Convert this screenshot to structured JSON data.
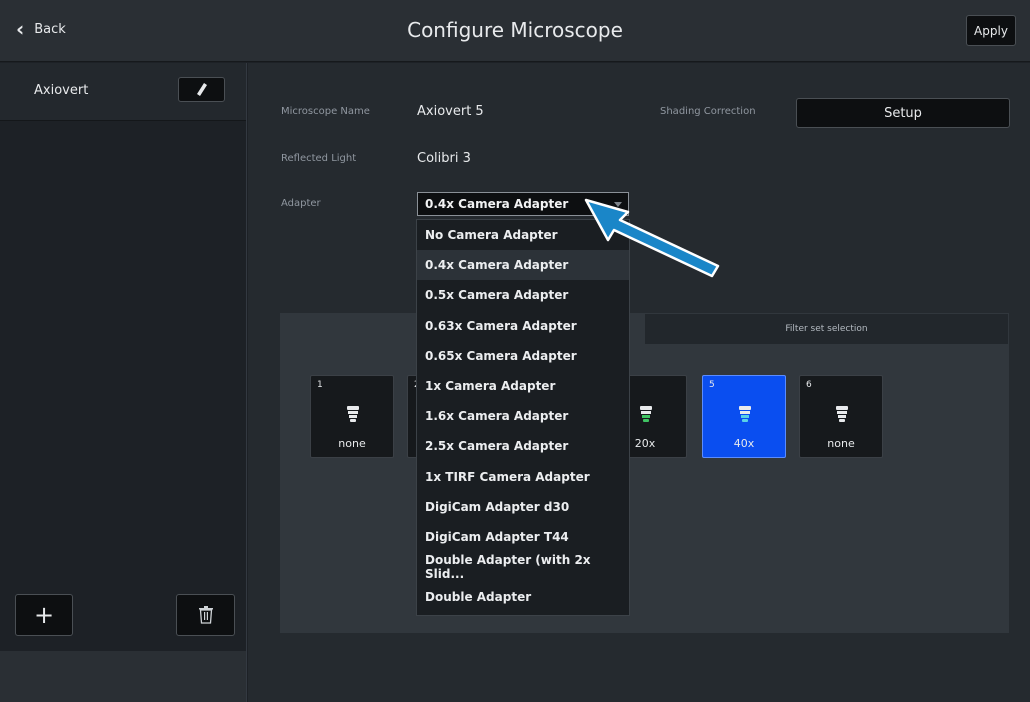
{
  "header": {
    "back_label": "Back",
    "title": "Configure Microscope",
    "apply_label": "Apply"
  },
  "sidebar": {
    "items": [
      {
        "label": "Axiovert"
      }
    ],
    "add_label": "+"
  },
  "form": {
    "microscope_name_label": "Microscope Name",
    "microscope_name_value": "Axiovert 5",
    "reflected_light_label": "Reflected Light",
    "reflected_light_value": "Colibri 3",
    "adapter_label": "Adapter",
    "adapter_value": "0.4x Camera Adapter",
    "shading_correction_label": "Shading Correction",
    "setup_label": "Setup"
  },
  "tabs": {
    "filter_set_selection": "Filter set selection"
  },
  "positions": [
    {
      "num": "1",
      "label": "none",
      "icon": "objective-white",
      "selected": false
    },
    {
      "num": "2",
      "label": "",
      "icon": "objective-white",
      "selected": false
    },
    {
      "num": "",
      "label": "20x",
      "icon": "objective-green",
      "selected": false
    },
    {
      "num": "5",
      "label": "40x",
      "icon": "objective-cyan",
      "selected": true
    },
    {
      "num": "6",
      "label": "none",
      "icon": "objective-white",
      "selected": false
    }
  ],
  "adapter_options": [
    "No Camera Adapter",
    "0.4x Camera Adapter",
    "0.5x Camera Adapter",
    "0.63x Camera Adapter",
    "0.65x Camera Adapter",
    "1x Camera Adapter",
    "1.6x Camera Adapter",
    "2.5x Camera Adapter",
    "1x TIRF Camera Adapter",
    "DigiCam Adapter d30",
    "DigiCam Adapter T44",
    "Double Adapter (with 2x Slid...",
    "Double Adapter"
  ],
  "highlighted_option_index": 1,
  "colors": {
    "accent_selected": "#0a4ef0",
    "arrow_annotation": "#1a86c8"
  }
}
